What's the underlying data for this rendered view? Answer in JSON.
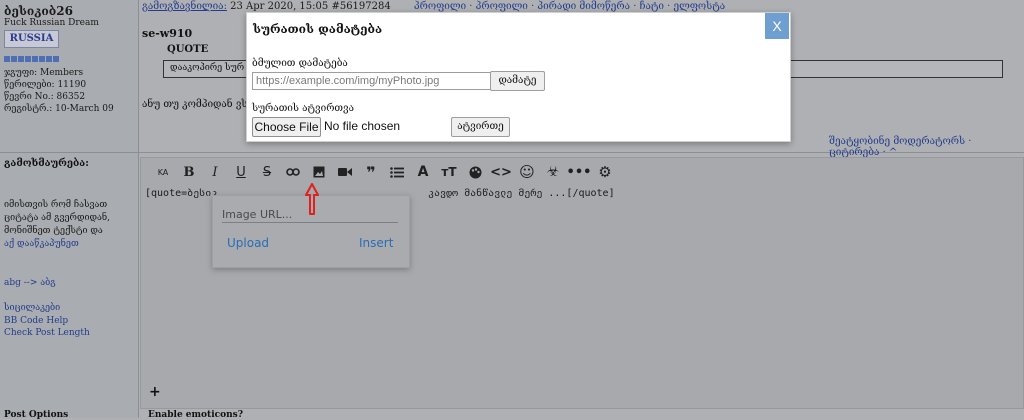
{
  "user": {
    "name": "ბესიკიბ26",
    "tagline": "Fuck Russian Dream",
    "logo_text": "RUSSIA",
    "group": "ჯგუფი: Members",
    "posts": "წერილები: 11190",
    "member_no": "წევრი No.: 86352",
    "registered": "რეგისტრ.: 10-March 09"
  },
  "post": {
    "author_link": "გამოგზავნილია:",
    "date": "23 Apr 2020, 15:05",
    "post_id": "#56197284",
    "nav_links": "პროფილი · პროფილი · პირადი მიმოწერა · ჩატი · ელფოსტა",
    "quoted_user": "se-w910",
    "quote_label": "QUOTE",
    "quote_text": "დააკოპირე სურ",
    "body": "ანუ თუ კომპიდან ვს",
    "actions": "შეატყობინე მოდერატორს · ციტირება · ^"
  },
  "reply": {
    "label": "გამოხმაურება:",
    "help_1": "იმისთვის რომ ჩასვათ",
    "help_2": "ციტატა ამ გვერდიდან,",
    "help_3": "მონიშნეთ ტექსტი და",
    "help_link": "აქ დააწკაპუნეთ",
    "translit": "abg --> აბგ",
    "smilies": "სიცილაკები",
    "bbcode": "BB Code Help",
    "check_length": "Check Post Length",
    "editor_text": "[quote=ბესიკ                                   კავდო მანწავლე მერე ...[/quote]",
    "bottom_label": "Post Options",
    "bottom_opt": "Enable emoticons?"
  },
  "toolbar": {
    "items": [
      "KA",
      "B",
      "I",
      "U",
      "S",
      "link",
      "image",
      "video",
      "quote",
      "list",
      "font",
      "size",
      "palette",
      "code",
      "emoji",
      "hazard",
      "more",
      "settings"
    ]
  },
  "image_popup": {
    "placeholder": "Image URL...",
    "upload": "Upload",
    "insert": "Insert"
  },
  "modal": {
    "title": "სურათის დამატება",
    "url_label": "ბმულით დამატება",
    "url_placeholder": "https://example.com/img/myPhoto.jpg",
    "add_button": "დამატე",
    "upload_label": "სურათის ატვირთვა",
    "choose_file": "Choose File",
    "no_file": "No file chosen",
    "upload_button": "ატვირთე",
    "close": "X"
  },
  "colors": {
    "accent": "#6f9ed1",
    "link": "#233c8c",
    "arrow": "#e02020"
  }
}
